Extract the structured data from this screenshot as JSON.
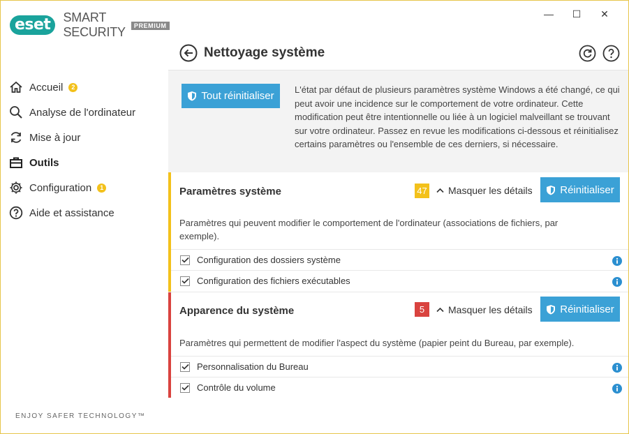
{
  "app": {
    "logo": "eset",
    "product": "SMART SECURITY",
    "edition": "PREMIUM",
    "slogan": "ENJOY SAFER TECHNOLOGY™"
  },
  "window_controls": {
    "minimize": "—",
    "maximize": "☐",
    "close": "✕"
  },
  "sidebar": {
    "items": [
      {
        "label": "Accueil",
        "icon": "home-icon",
        "badge": "2",
        "active": false
      },
      {
        "label": "Analyse de l'ordinateur",
        "icon": "search-icon",
        "active": false
      },
      {
        "label": "Mise à jour",
        "icon": "refresh-icon",
        "active": false
      },
      {
        "label": "Outils",
        "icon": "toolbox-icon",
        "active": true
      },
      {
        "label": "Configuration",
        "icon": "gear-icon",
        "badge": "1",
        "active": false
      },
      {
        "label": "Aide et assistance",
        "icon": "help-icon",
        "active": false
      }
    ]
  },
  "header": {
    "title": "Nettoyage système"
  },
  "intro": {
    "reset_all_label": "Tout réinitialiser",
    "text": "L'état par défaut de plusieurs paramètres système Windows a été changé, ce qui peut avoir une incidence sur le comportement de votre ordinateur. Cette modification peut être intentionnelle ou liée à un logiciel malveillant se trouvant sur votre ordinateur. Passez en revue les modifications ci-dessous et réinitialisez certains paramètres ou l'ensemble de ces derniers, si nécessaire."
  },
  "sections": [
    {
      "title": "Paramètres système",
      "count": "47",
      "color": "#f3c11b",
      "badge_color": "#f3c11b",
      "toggle_label": "Masquer les détails",
      "reset_label": "Réinitialiser",
      "description": "Paramètres qui peuvent modifier le comportement de l'ordinateur (associations de fichiers, par exemple).",
      "items": [
        {
          "label": "Configuration des dossiers système",
          "checked": true
        },
        {
          "label": "Configuration des fichiers exécutables",
          "checked": true
        }
      ]
    },
    {
      "title": "Apparence du système",
      "count": "5",
      "color": "#d9433f",
      "badge_color": "#d9433f",
      "toggle_label": "Masquer les détails",
      "reset_label": "Réinitialiser",
      "description": "Paramètres qui permettent de modifier l'aspect du système (papier peint du Bureau, par exemple).",
      "items": [
        {
          "label": "Personnalisation du Bureau",
          "checked": true
        },
        {
          "label": "Contrôle du volume",
          "checked": true
        }
      ]
    }
  ],
  "colors": {
    "accent_blue": "#3ba1d6",
    "brand_teal": "#1aa39c",
    "warning_yellow": "#f3c11b",
    "alert_red": "#d9433f",
    "info_blue": "#2b8fd0"
  }
}
